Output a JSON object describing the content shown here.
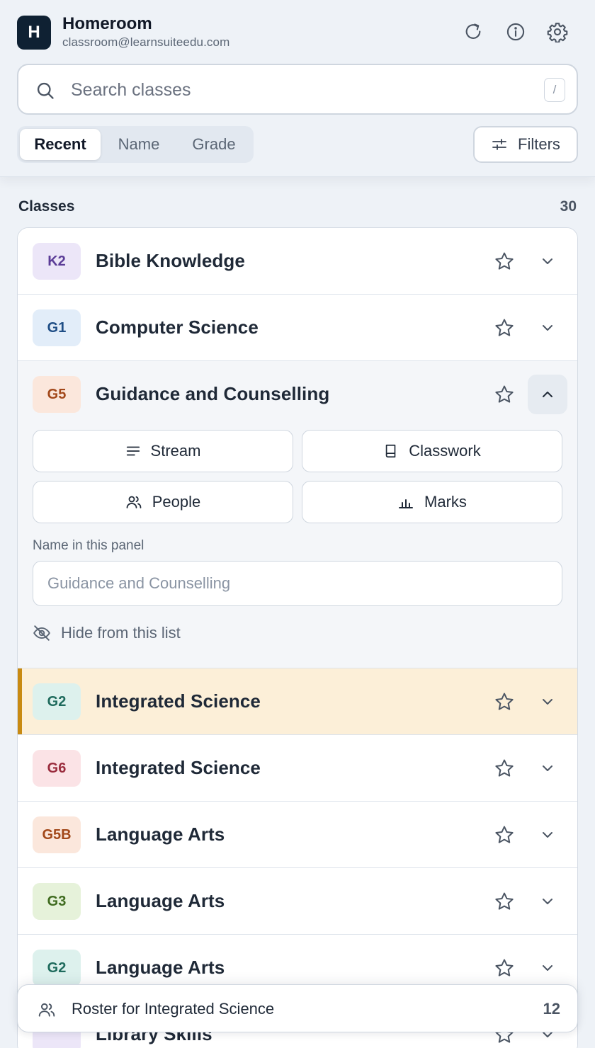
{
  "app": {
    "logo_letter": "H",
    "title": "Homeroom",
    "email": "classroom@learnsuiteedu.com"
  },
  "header_icons": [
    "refresh-icon",
    "info-icon",
    "settings-icon"
  ],
  "search": {
    "placeholder": "Search classes",
    "value": "",
    "shortcut": "/"
  },
  "sort_tabs": [
    {
      "label": "Recent",
      "active": true
    },
    {
      "label": "Name",
      "active": false
    },
    {
      "label": "Grade",
      "active": false
    }
  ],
  "filters_label": "Filters",
  "section": {
    "title": "Classes",
    "count": "30"
  },
  "classes": [
    {
      "badge": "K2",
      "badge_bg": "#ece6f8",
      "badge_fg": "#5b3c97",
      "title": "Bible Knowledge",
      "expanded": false,
      "highlighted": false
    },
    {
      "badge": "G1",
      "badge_bg": "#e2edf9",
      "badge_fg": "#1f4e86",
      "title": "Computer Science",
      "expanded": false,
      "highlighted": false
    },
    {
      "badge": "G5",
      "badge_bg": "#fbe7dc",
      "badge_fg": "#a2481a",
      "title": "Guidance and Counselling",
      "expanded": true,
      "highlighted": false
    },
    {
      "badge": "G2",
      "badge_bg": "#ddf1ed",
      "badge_fg": "#1f6b5d",
      "title": "Integrated Science",
      "expanded": false,
      "highlighted": true
    },
    {
      "badge": "G6",
      "badge_bg": "#fbe3e6",
      "badge_fg": "#9a2c3d",
      "title": "Integrated Science",
      "expanded": false,
      "highlighted": false
    },
    {
      "badge": "G5B",
      "badge_bg": "#fbe7dc",
      "badge_fg": "#a2481a",
      "title": "Language Arts",
      "expanded": false,
      "highlighted": false
    },
    {
      "badge": "G3",
      "badge_bg": "#e6f2da",
      "badge_fg": "#3f6b1f",
      "title": "Language Arts",
      "expanded": false,
      "highlighted": false
    },
    {
      "badge": "G2",
      "badge_bg": "#ddf1ed",
      "badge_fg": "#1f6b5d",
      "title": "Language Arts",
      "expanded": false,
      "highlighted": false
    },
    {
      "badge": "",
      "badge_bg": "#ece6f8",
      "badge_fg": "#5b3c97",
      "title": "Library Skills",
      "expanded": false,
      "highlighted": false
    }
  ],
  "expanded_panel": {
    "actions": {
      "stream": "Stream",
      "classwork": "Classwork",
      "people": "People",
      "marks": "Marks"
    },
    "name_label": "Name in this panel",
    "name_placeholder": "Guidance and Counselling",
    "name_value": "",
    "hide_label": "Hide from this list"
  },
  "roster": {
    "label": "Roster for Integrated Science",
    "count": "12"
  },
  "colors": {
    "highlight_bg": "#fcefd8",
    "highlight_accent": "#c88a12",
    "logo_bg": "#0f2133"
  }
}
